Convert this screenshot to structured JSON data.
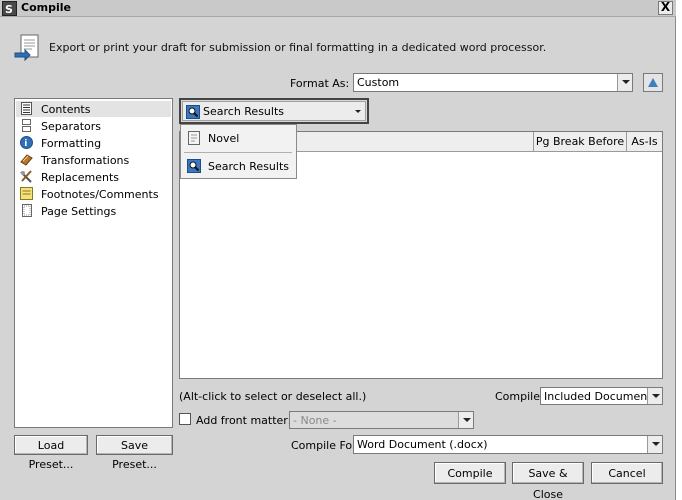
{
  "window": {
    "title": "Compile",
    "close_label": "X",
    "description": "Export or print your draft for submission or final formatting in a dedicated word processor."
  },
  "format_as": {
    "label": "Format As:",
    "value": "Custom"
  },
  "sidebar": {
    "items": [
      {
        "label": "Contents",
        "icon": "contents-icon"
      },
      {
        "label": "Separators",
        "icon": "separators-icon"
      },
      {
        "label": "Formatting",
        "icon": "formatting-icon"
      },
      {
        "label": "Transformations",
        "icon": "transformations-icon"
      },
      {
        "label": "Replacements",
        "icon": "replacements-icon"
      },
      {
        "label": "Footnotes/Comments",
        "icon": "footnotes-icon"
      },
      {
        "label": "Page Settings",
        "icon": "page-settings-icon"
      }
    ],
    "selected": "Contents"
  },
  "contents_selector": {
    "value": "Search Results",
    "options": [
      {
        "label": "Novel",
        "icon": "novel-icon"
      },
      {
        "label": "Search Results",
        "icon": "search-results-icon"
      }
    ]
  },
  "table": {
    "columns": [
      "Pg Break Before",
      "As-Is"
    ]
  },
  "hint": "(Alt-click to select or deselect all.)",
  "compile_filter": {
    "label": "Compile:",
    "value": "Included Documents"
  },
  "front_matter": {
    "label": "Add front matter:",
    "value": "- None -",
    "checked": false
  },
  "compile_for": {
    "label": "Compile For:",
    "value": "Word Document (.docx)"
  },
  "buttons": {
    "load_preset": "Load Preset...",
    "save_preset": "Save Preset...",
    "compile": "Compile",
    "save_close": "Save & Close",
    "cancel": "Cancel"
  },
  "colors": {
    "window_bg": "#d4d4d4",
    "accent_blue": "#3e7fc2",
    "selection": "#e3e3e3"
  }
}
